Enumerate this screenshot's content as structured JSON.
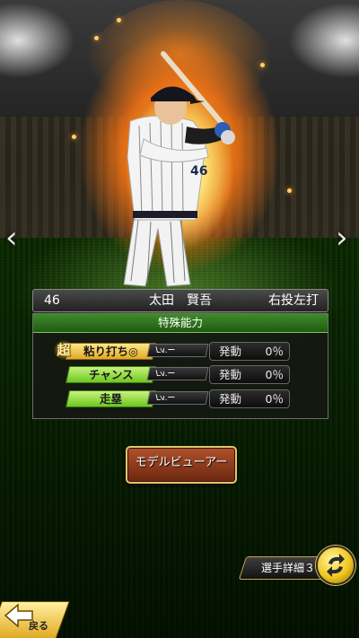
{
  "player": {
    "number": "46",
    "name": "太田　賢吾",
    "handedness": "右投左打",
    "jersey_number": "46"
  },
  "abilities_panel": {
    "title": "特殊能力",
    "items": [
      {
        "super_mark": "超",
        "label": "粘り打ち◎",
        "lv_prefix": "Lv.",
        "lv_value": "ー",
        "status": "発動",
        "percent": "0％",
        "tag_color": "#f2c33a"
      },
      {
        "label": "チャンス",
        "lv_prefix": "Lv.",
        "lv_value": "ー",
        "status": "発動",
        "percent": "0％",
        "tag_color": "#8ad83c"
      },
      {
        "label": "走塁",
        "lv_prefix": "Lv.",
        "lv_value": "ー",
        "status": "発動",
        "percent": "0％",
        "tag_color": "#8ad83c"
      }
    ]
  },
  "buttons": {
    "model_viewer": "モデルビューアー",
    "player_detail": "選手詳細３",
    "back": "戻る"
  },
  "icons": {
    "prev": "chevron-left-icon",
    "next": "chevron-right-icon",
    "swap": "swap-icon",
    "back": "back-arrow-icon"
  },
  "colors": {
    "panel_header": "#2e7a1e",
    "model_button": "#8f3c1a",
    "gold_accent": "#e8c254"
  }
}
